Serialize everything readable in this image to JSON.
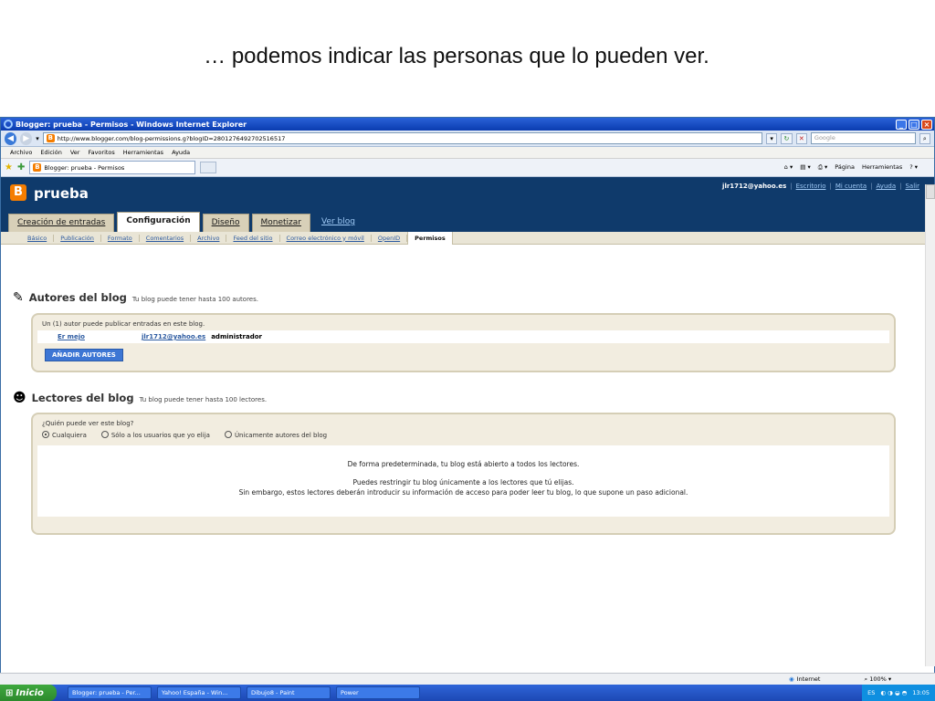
{
  "slide": {
    "caption": "… podemos indicar las personas que lo pueden ver."
  },
  "window": {
    "title": "Blogger: prueba - Permisos - Windows Internet Explorer",
    "url": "http://www.blogger.com/blog-permissions.g?blogID=2801276492702516517",
    "search_placeholder": "Google",
    "menu": [
      "Archivo",
      "Edición",
      "Ver",
      "Favoritos",
      "Herramientas",
      "Ayuda"
    ],
    "tab_label": "Blogger: prueba - Permisos",
    "commands": {
      "page": "Página",
      "tools": "Herramientas"
    }
  },
  "blog": {
    "title": "prueba",
    "logo_letter": "B",
    "user_email": "jlr1712@yahoo.es",
    "links": [
      "Escritorio",
      "Mi cuenta",
      "Ayuda",
      "Salir"
    ],
    "main_tabs": [
      "Creación de entradas",
      "Configuración",
      "Diseño",
      "Monetizar"
    ],
    "view_blog": "Ver blog",
    "sub_tabs": [
      "Básico",
      "Publicación",
      "Formato",
      "Comentarios",
      "Archivo",
      "Feed del sitio",
      "Correo electrónico y móvil",
      "OpenID",
      "Permisos"
    ]
  },
  "authors": {
    "title": "Autores del blog",
    "subtitle": "Tu blog puede tener hasta 100 autores.",
    "note": "Un (1) autor puede publicar entradas en este blog.",
    "rows": [
      {
        "name": "Er mejo",
        "email": "jlr1712@yahoo.es",
        "role": "administrador"
      }
    ],
    "add_button": "AÑADIR AUTORES"
  },
  "readers": {
    "title": "Lectores del blog",
    "subtitle": "Tu blog puede tener hasta 100 lectores.",
    "question": "¿Quién puede ver este blog?",
    "options": [
      "Cualquiera",
      "Sólo a los usuarios que yo elija",
      "Únicamente autores del blog"
    ],
    "selected": "Cualquiera",
    "info_1": "De forma predeterminada, tu blog está abierto a todos los lectores.",
    "info_2": "Puedes restringir tu blog únicamente a los lectores que tú elijas.",
    "info_3": "Sin embargo, estos lectores deberán introducir su información de acceso para poder leer tu blog, lo que supone un paso adicional."
  },
  "status": {
    "zone": "Internet",
    "zoom": "100%"
  },
  "taskbar": {
    "start": "Inicio",
    "items": [
      "Blogger: prueba - Per...",
      "Yahoo! España - Win...",
      "Dibujo8 - Paint",
      "Power"
    ],
    "lang": "ES",
    "clock": "13:05"
  }
}
